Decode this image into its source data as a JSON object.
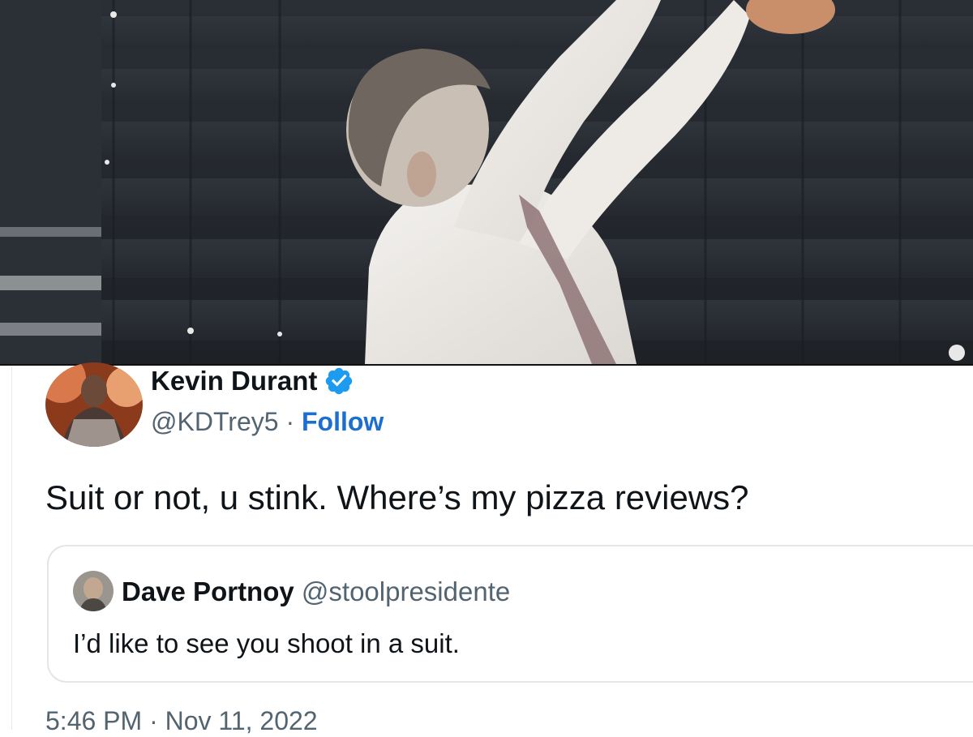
{
  "tweet": {
    "author": {
      "name": "Kevin Durant",
      "handle": "@KDTrey5",
      "separator": "·",
      "follow_label": "Follow",
      "verified": true
    },
    "text": "Suit or not, u stink. Where’s my pizza reviews?",
    "quoted_tweet": {
      "name": "Dave Portnoy",
      "handle": "@stoolpresidente",
      "text": "I’d like to see you shoot in a suit."
    },
    "timestamp": "5:46 PM · Nov 11, 2022"
  },
  "icons": {
    "verified": "verified-badge-icon"
  },
  "colors": {
    "text_primary": "#0f1419",
    "text_secondary": "#536471",
    "link": "#1d6fcf",
    "verified": "#1d9bf0"
  }
}
